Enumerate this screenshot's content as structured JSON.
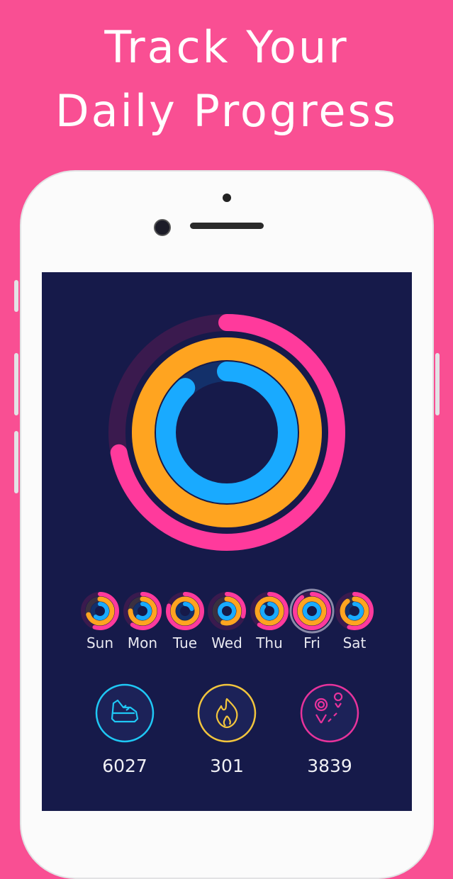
{
  "headline": {
    "line1": "Track Your",
    "line2": "Daily Progress"
  },
  "colors": {
    "background": "#f94f93",
    "screen": "#161a4a",
    "move": "#ff3a9c",
    "exercise": "#ffa420",
    "stand": "#19aaff"
  },
  "main_rings": {
    "move": 0.72,
    "exercise": 1.0,
    "stand": 0.88
  },
  "days": [
    {
      "label": "Sun",
      "move": 0.55,
      "exercise": 0.7,
      "stand": 0.6
    },
    {
      "label": "Mon",
      "move": 0.6,
      "exercise": 0.75,
      "stand": 0.6
    },
    {
      "label": "Tue",
      "move": 0.8,
      "exercise": 1.0,
      "stand": 0.2
    },
    {
      "label": "Wed",
      "move": 0.3,
      "exercise": 0.55,
      "stand": 1.0
    },
    {
      "label": "Thu",
      "move": 0.6,
      "exercise": 1.0,
      "stand": 0.85
    },
    {
      "label": "Fri",
      "move": 0.9,
      "exercise": 1.0,
      "stand": 1.0,
      "selected": true
    },
    {
      "label": "Sat",
      "move": 0.55,
      "exercise": 0.9,
      "stand": 0.6
    }
  ],
  "stats": [
    {
      "icon": "shoe-icon",
      "value": "6027",
      "color": "#1fc8f5"
    },
    {
      "icon": "flame-icon",
      "value": "301",
      "color": "#f2c53d"
    },
    {
      "icon": "route-icon",
      "value": "3839",
      "color": "#e8339c"
    }
  ]
}
